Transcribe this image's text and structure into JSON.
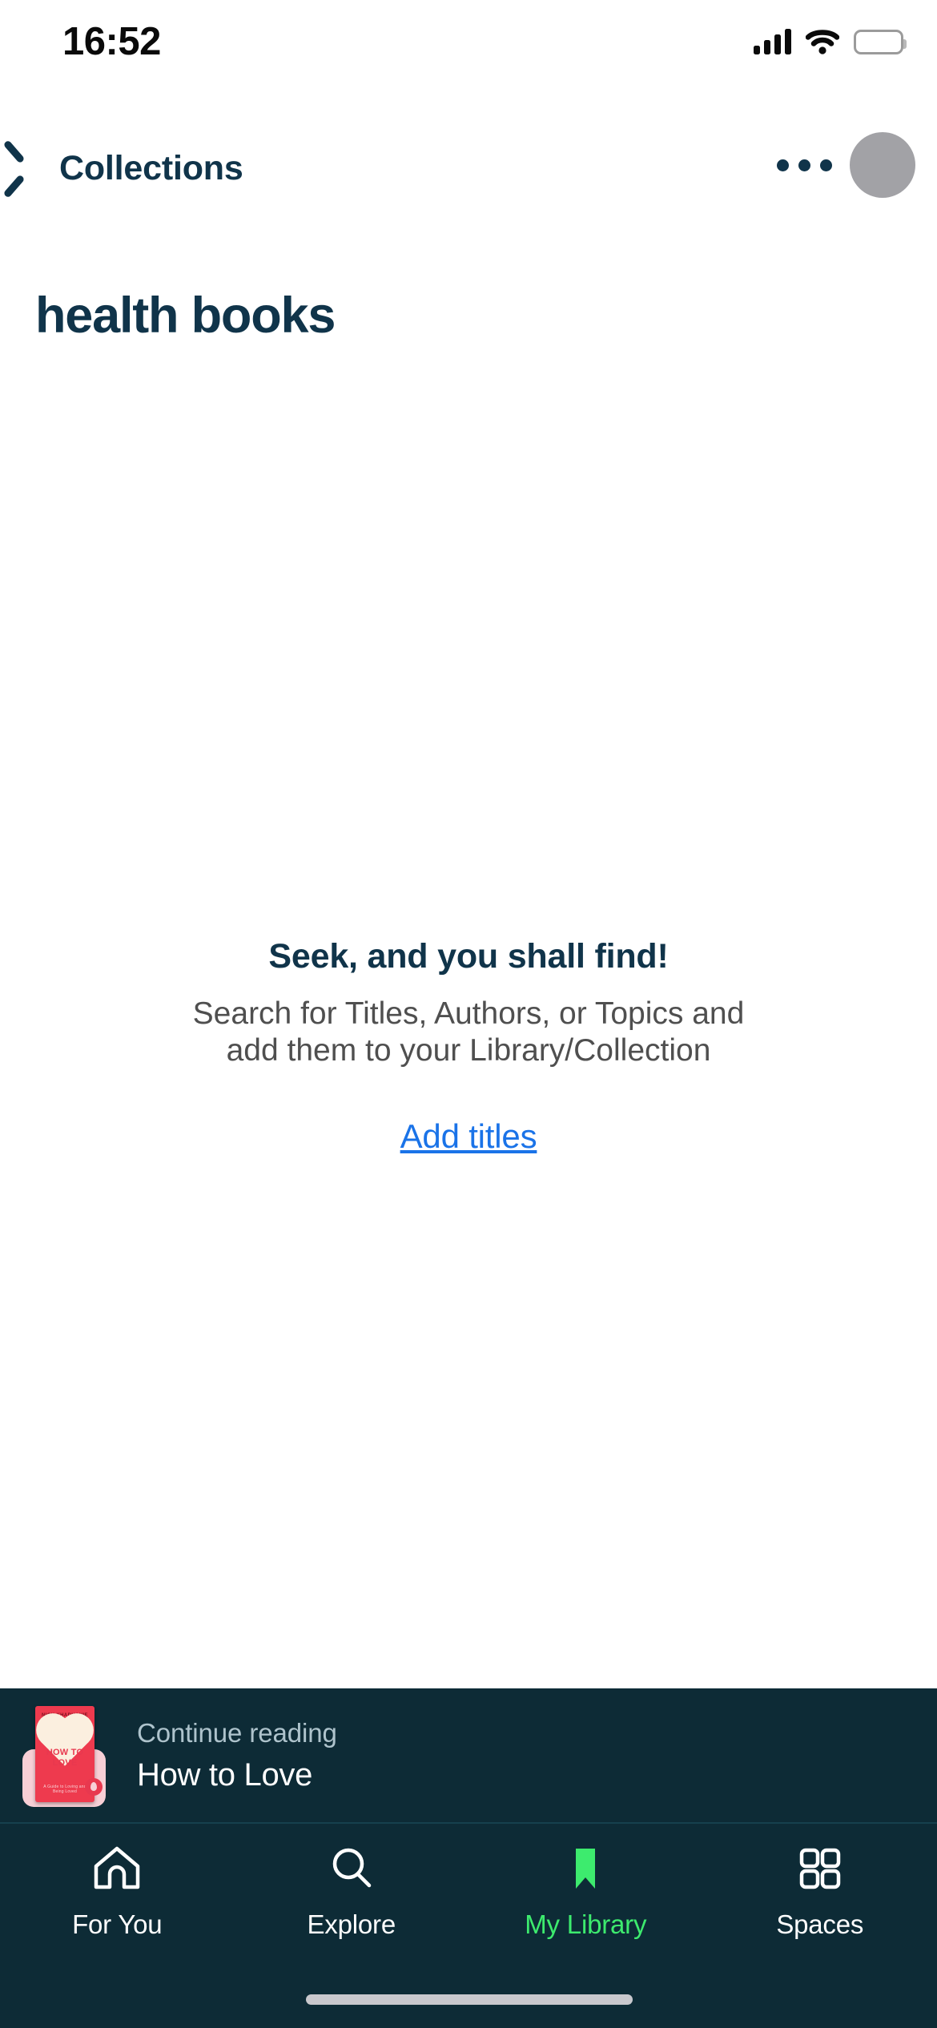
{
  "status_bar": {
    "time": "16:52",
    "icons": [
      "cellular-signal-icon",
      "wifi-icon",
      "battery-icon"
    ],
    "battery_color": "#FFD60A"
  },
  "nav_bar": {
    "back_label": "Collections",
    "back_icon": "chevron-left-icon",
    "overflow_icon": "ellipsis-icon",
    "avatar": "user-avatar",
    "color": "#10344A"
  },
  "page": {
    "title": "health books"
  },
  "empty_state": {
    "title": "Seek, and you shall find!",
    "description": "Search for Titles, Authors, or Topics and add them to your Library/Collection",
    "action_label": "Add titles",
    "action_color": "#1a73e8"
  },
  "continue_reading": {
    "label": "Continue reading",
    "title": "How to Love",
    "cover": {
      "author": "NICK KHADHANIE",
      "title_line1": "HOW TO",
      "title_line2": "LOVE",
      "subtitle": "A Guide to Loving and Being Loved",
      "background_color": "#EE3A4E",
      "heart_color": "#FBEFDF"
    },
    "background_color": "#0D2B36"
  },
  "tab_bar": {
    "active_color": "#3DEB6E",
    "background_color": "#0D2B36",
    "items": [
      {
        "label": "For You",
        "icon": "home-icon",
        "active": false
      },
      {
        "label": "Explore",
        "icon": "search-icon",
        "active": false
      },
      {
        "label": "My Library",
        "icon": "bookmark-icon",
        "active": true
      },
      {
        "label": "Spaces",
        "icon": "grid-icon",
        "active": false
      }
    ]
  }
}
